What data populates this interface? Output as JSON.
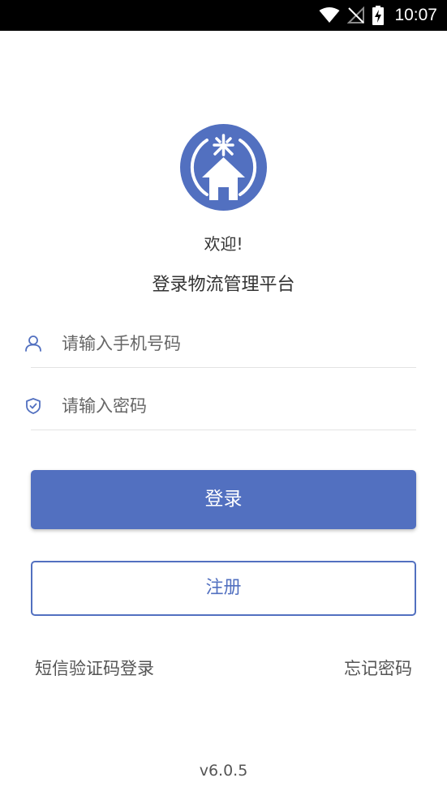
{
  "status_bar": {
    "time": "10:07"
  },
  "header": {
    "welcome": "欢迎!",
    "subtitle": "登录物流管理平台"
  },
  "form": {
    "phone_placeholder": "请输入手机号码",
    "password_placeholder": "请输入密码",
    "login_label": "登录",
    "register_label": "注册"
  },
  "links": {
    "sms_login": "短信验证码登录",
    "forgot_password": "忘记密码"
  },
  "footer": {
    "version": "v6.0.5"
  },
  "colors": {
    "accent": "#5270c0",
    "status_bar": "#000000",
    "divider": "#e3e3e3"
  },
  "icons": [
    "wifi-icon",
    "no-signal-icon",
    "battery-charging-icon",
    "app-logo",
    "user-icon",
    "shield-check-icon"
  ]
}
